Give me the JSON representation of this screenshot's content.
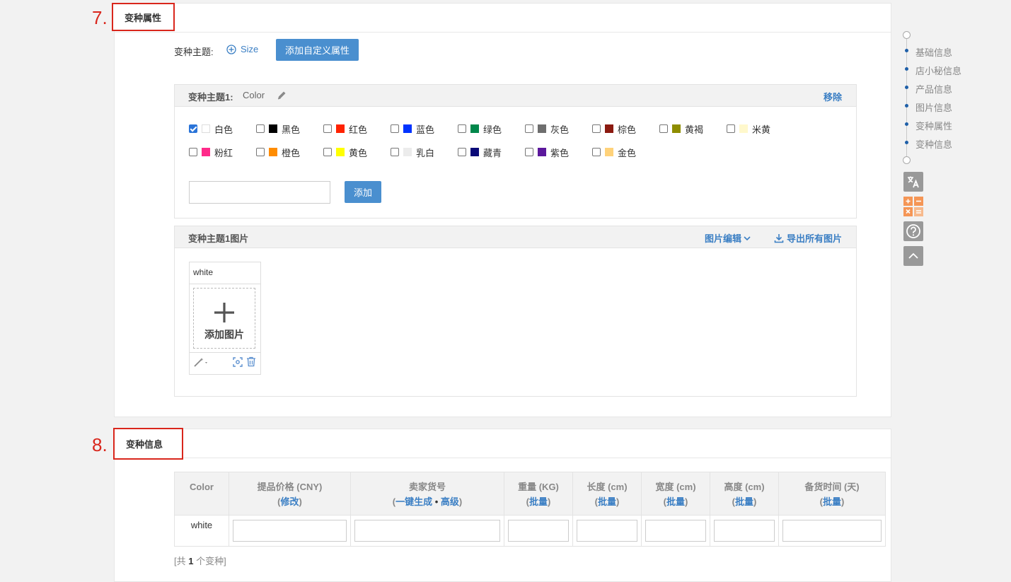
{
  "annotations": {
    "step7": "7.",
    "step8": "8."
  },
  "section7": {
    "title": "变种属性",
    "theme_label": "变种主题:",
    "add_size_label": "Size",
    "add_custom_button": "添加自定义属性",
    "theme1": {
      "title": "变种主题1:",
      "name": "Color",
      "remove_label": "移除",
      "colors": [
        {
          "label": "白色",
          "swatch": "#ffffff",
          "checked": true
        },
        {
          "label": "黑色",
          "swatch": "#000000",
          "checked": false
        },
        {
          "label": "红色",
          "swatch": "#ff2200",
          "checked": false
        },
        {
          "label": "蓝色",
          "swatch": "#0033ff",
          "checked": false
        },
        {
          "label": "绿色",
          "swatch": "#00874b",
          "checked": false
        },
        {
          "label": "灰色",
          "swatch": "#6e6e6e",
          "checked": false
        },
        {
          "label": "棕色",
          "swatch": "#8b1a10",
          "checked": false
        },
        {
          "label": "黄褐",
          "swatch": "#8e8d00",
          "checked": false
        },
        {
          "label": "米黄",
          "swatch": "#fff8cc",
          "checked": false
        },
        {
          "label": "粉红",
          "swatch": "#ff2a8a",
          "checked": false
        },
        {
          "label": "橙色",
          "swatch": "#ff8c00",
          "checked": false
        },
        {
          "label": "黄色",
          "swatch": "#ffff00",
          "checked": false
        },
        {
          "label": "乳白",
          "swatch": "#ececec",
          "checked": false
        },
        {
          "label": "藏青",
          "swatch": "#0a0a78",
          "checked": false
        },
        {
          "label": "紫色",
          "swatch": "#5b189c",
          "checked": false
        },
        {
          "label": "金色",
          "swatch": "#ffd27a",
          "checked": false
        }
      ],
      "add_input_value": "",
      "add_button": "添加"
    },
    "images": {
      "title": "变种主题1图片",
      "edit_label": "图片编辑",
      "export_label": "导出所有图片",
      "card_label": "white",
      "add_image_label": "添加图片"
    }
  },
  "section8": {
    "title": "变种信息",
    "table": {
      "headers": [
        {
          "label": "Color",
          "action": ""
        },
        {
          "label": "提品价格 (CNY)",
          "action": "修改"
        },
        {
          "label": "卖家货号",
          "action": "一键生成",
          "action2": "高级"
        },
        {
          "label": "重量 (KG)",
          "action": "批量"
        },
        {
          "label": "长度 (cm)",
          "action": "批量"
        },
        {
          "label": "宽度 (cm)",
          "action": "批量"
        },
        {
          "label": "高度 (cm)",
          "action": "批量"
        },
        {
          "label": "备货时间 (天)",
          "action": "批量"
        }
      ],
      "rows": [
        {
          "color": "white"
        }
      ]
    },
    "count_prefix": "[共 ",
    "count_value": "1",
    "count_suffix": " 个变种]"
  },
  "side_nav": {
    "items": [
      "基础信息",
      "店小秘信息",
      "产品信息",
      "图片信息",
      "变种属性",
      "变种信息"
    ],
    "accent": "#1e5fa8"
  },
  "tools": [
    "translate-icon",
    "calculator-icon",
    "help-icon",
    "scroll-top-icon"
  ]
}
